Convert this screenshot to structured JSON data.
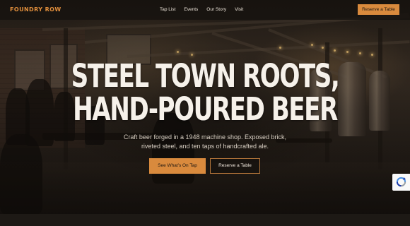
{
  "nav": {
    "logo": "FOUNDRY ROW",
    "links": [
      "Tap List",
      "Events",
      "Our Story",
      "Visit"
    ],
    "cta_label": "Reserve a Table"
  },
  "hero": {
    "title_line1": "STEEL TOWN ROOTS,",
    "title_line2": "HAND-POURED BEER",
    "subtitle_line1": "Craft beer forged in a 1948 machine shop. Exposed brick,",
    "subtitle_line2": "riveted steel, and ten taps of handcrafted ale.",
    "primary_button": "See What's On Tap",
    "secondary_button": "Reserve a Table",
    "background_image": "brewery-taproom-photo"
  },
  "recaptcha": {
    "icon": "recaptcha-icon"
  },
  "colors": {
    "accent": "#d98a3d",
    "logo": "#e08e3c",
    "nav_background": "#16120f",
    "text": "#f6f1ea"
  }
}
